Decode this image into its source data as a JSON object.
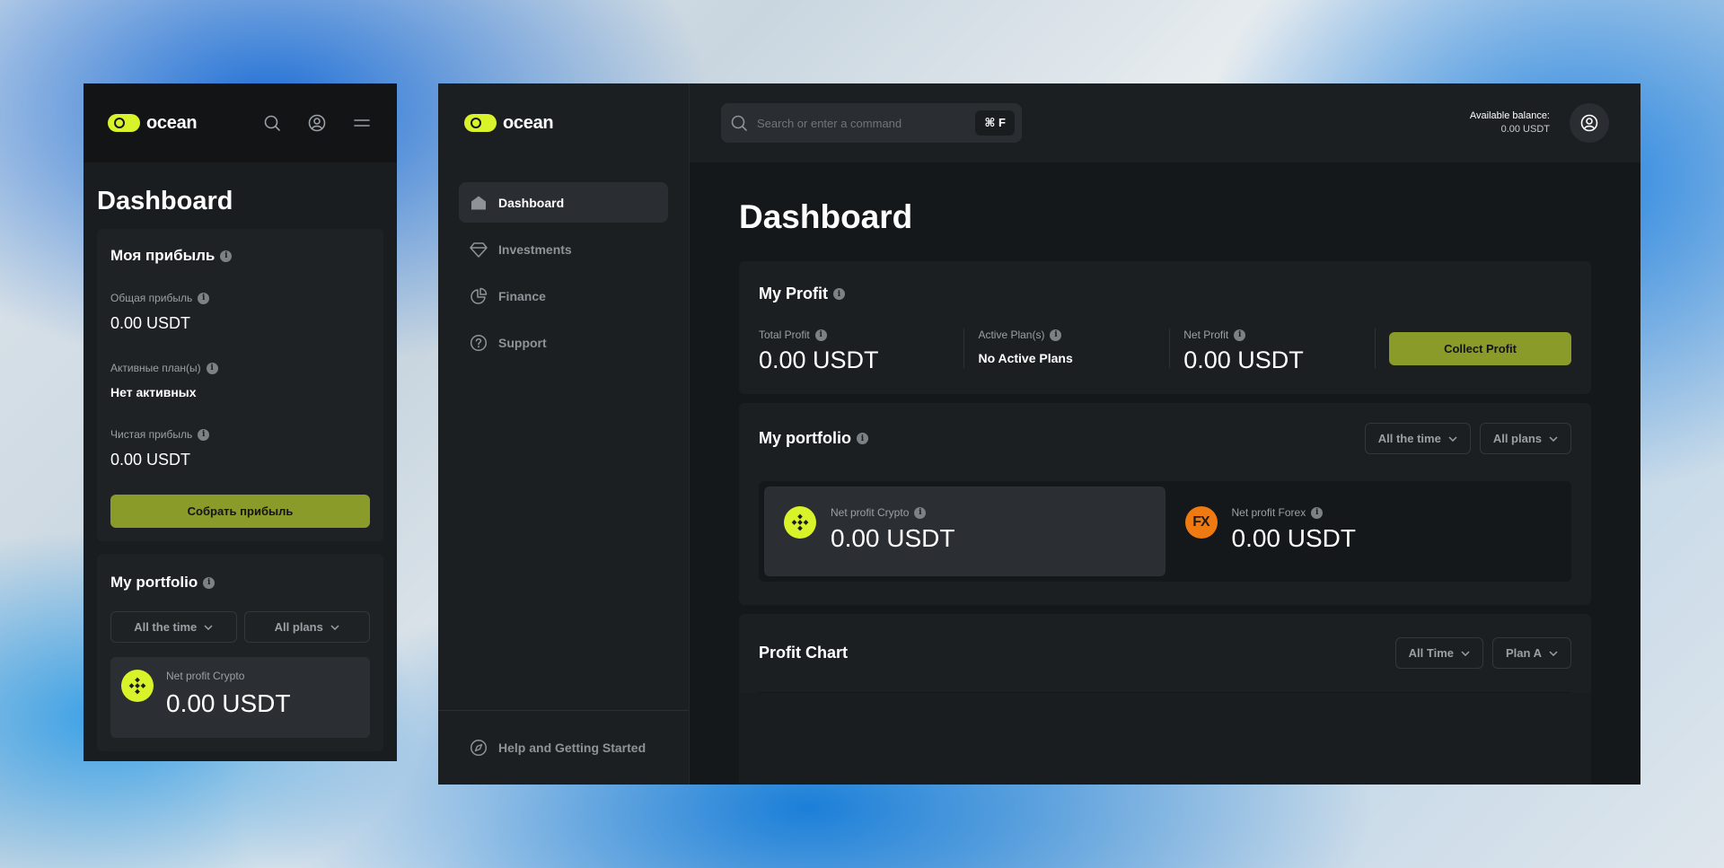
{
  "brand": {
    "name": "ocean",
    "accent": "#d8f32a",
    "button": "#8a9b2a"
  },
  "mobile": {
    "page_title": "Dashboard",
    "profit_card": {
      "title": "Моя прибыль",
      "total_label": "Общая прибыль",
      "total_value": "0.00 USDT",
      "active_label": "Активные план(ы)",
      "active_value": "Нет активных",
      "net_label": "Чистая прибыль",
      "net_value": "0.00 USDT",
      "collect_label": "Собрать прибыль"
    },
    "portfolio_card": {
      "title": "My portfolio",
      "time_filter": "All the time",
      "plan_filter": "All plans",
      "crypto_label": "Net profit Crypto",
      "crypto_value": "0.00 USDT"
    }
  },
  "desktop": {
    "nav": [
      {
        "label": "Dashboard",
        "icon": "home-icon",
        "active": true
      },
      {
        "label": "Investments",
        "icon": "diamond-icon"
      },
      {
        "label": "Finance",
        "icon": "pie-chart-icon"
      },
      {
        "label": "Support",
        "icon": "help-icon"
      }
    ],
    "help_label": "Help and Getting Started",
    "search": {
      "placeholder": "Search or enter a command",
      "shortcut": "⌘ F"
    },
    "balance": {
      "label": "Available balance:",
      "value": "0.00 USDT"
    },
    "page_title": "Dashboard",
    "profit_card": {
      "title": "My Profit",
      "total_label": "Total Profit",
      "total_value": "0.00 USDT",
      "active_label": "Active Plan(s)",
      "active_value": "No Active Plans",
      "net_label": "Net Profit",
      "net_value": "0.00 USDT",
      "collect_label": "Collect Profit"
    },
    "portfolio_card": {
      "title": "My portfolio",
      "time_filter": "All the time",
      "plan_filter": "All plans",
      "crypto_label": "Net profit Crypto",
      "crypto_value": "0.00 USDT",
      "forex_label": "Net profit Forex",
      "forex_value": "0.00 USDT",
      "forex_badge": "FX"
    },
    "chart_card": {
      "title": "Profit Chart",
      "time_filter": "All Time",
      "plan_filter": "Plan A"
    }
  }
}
